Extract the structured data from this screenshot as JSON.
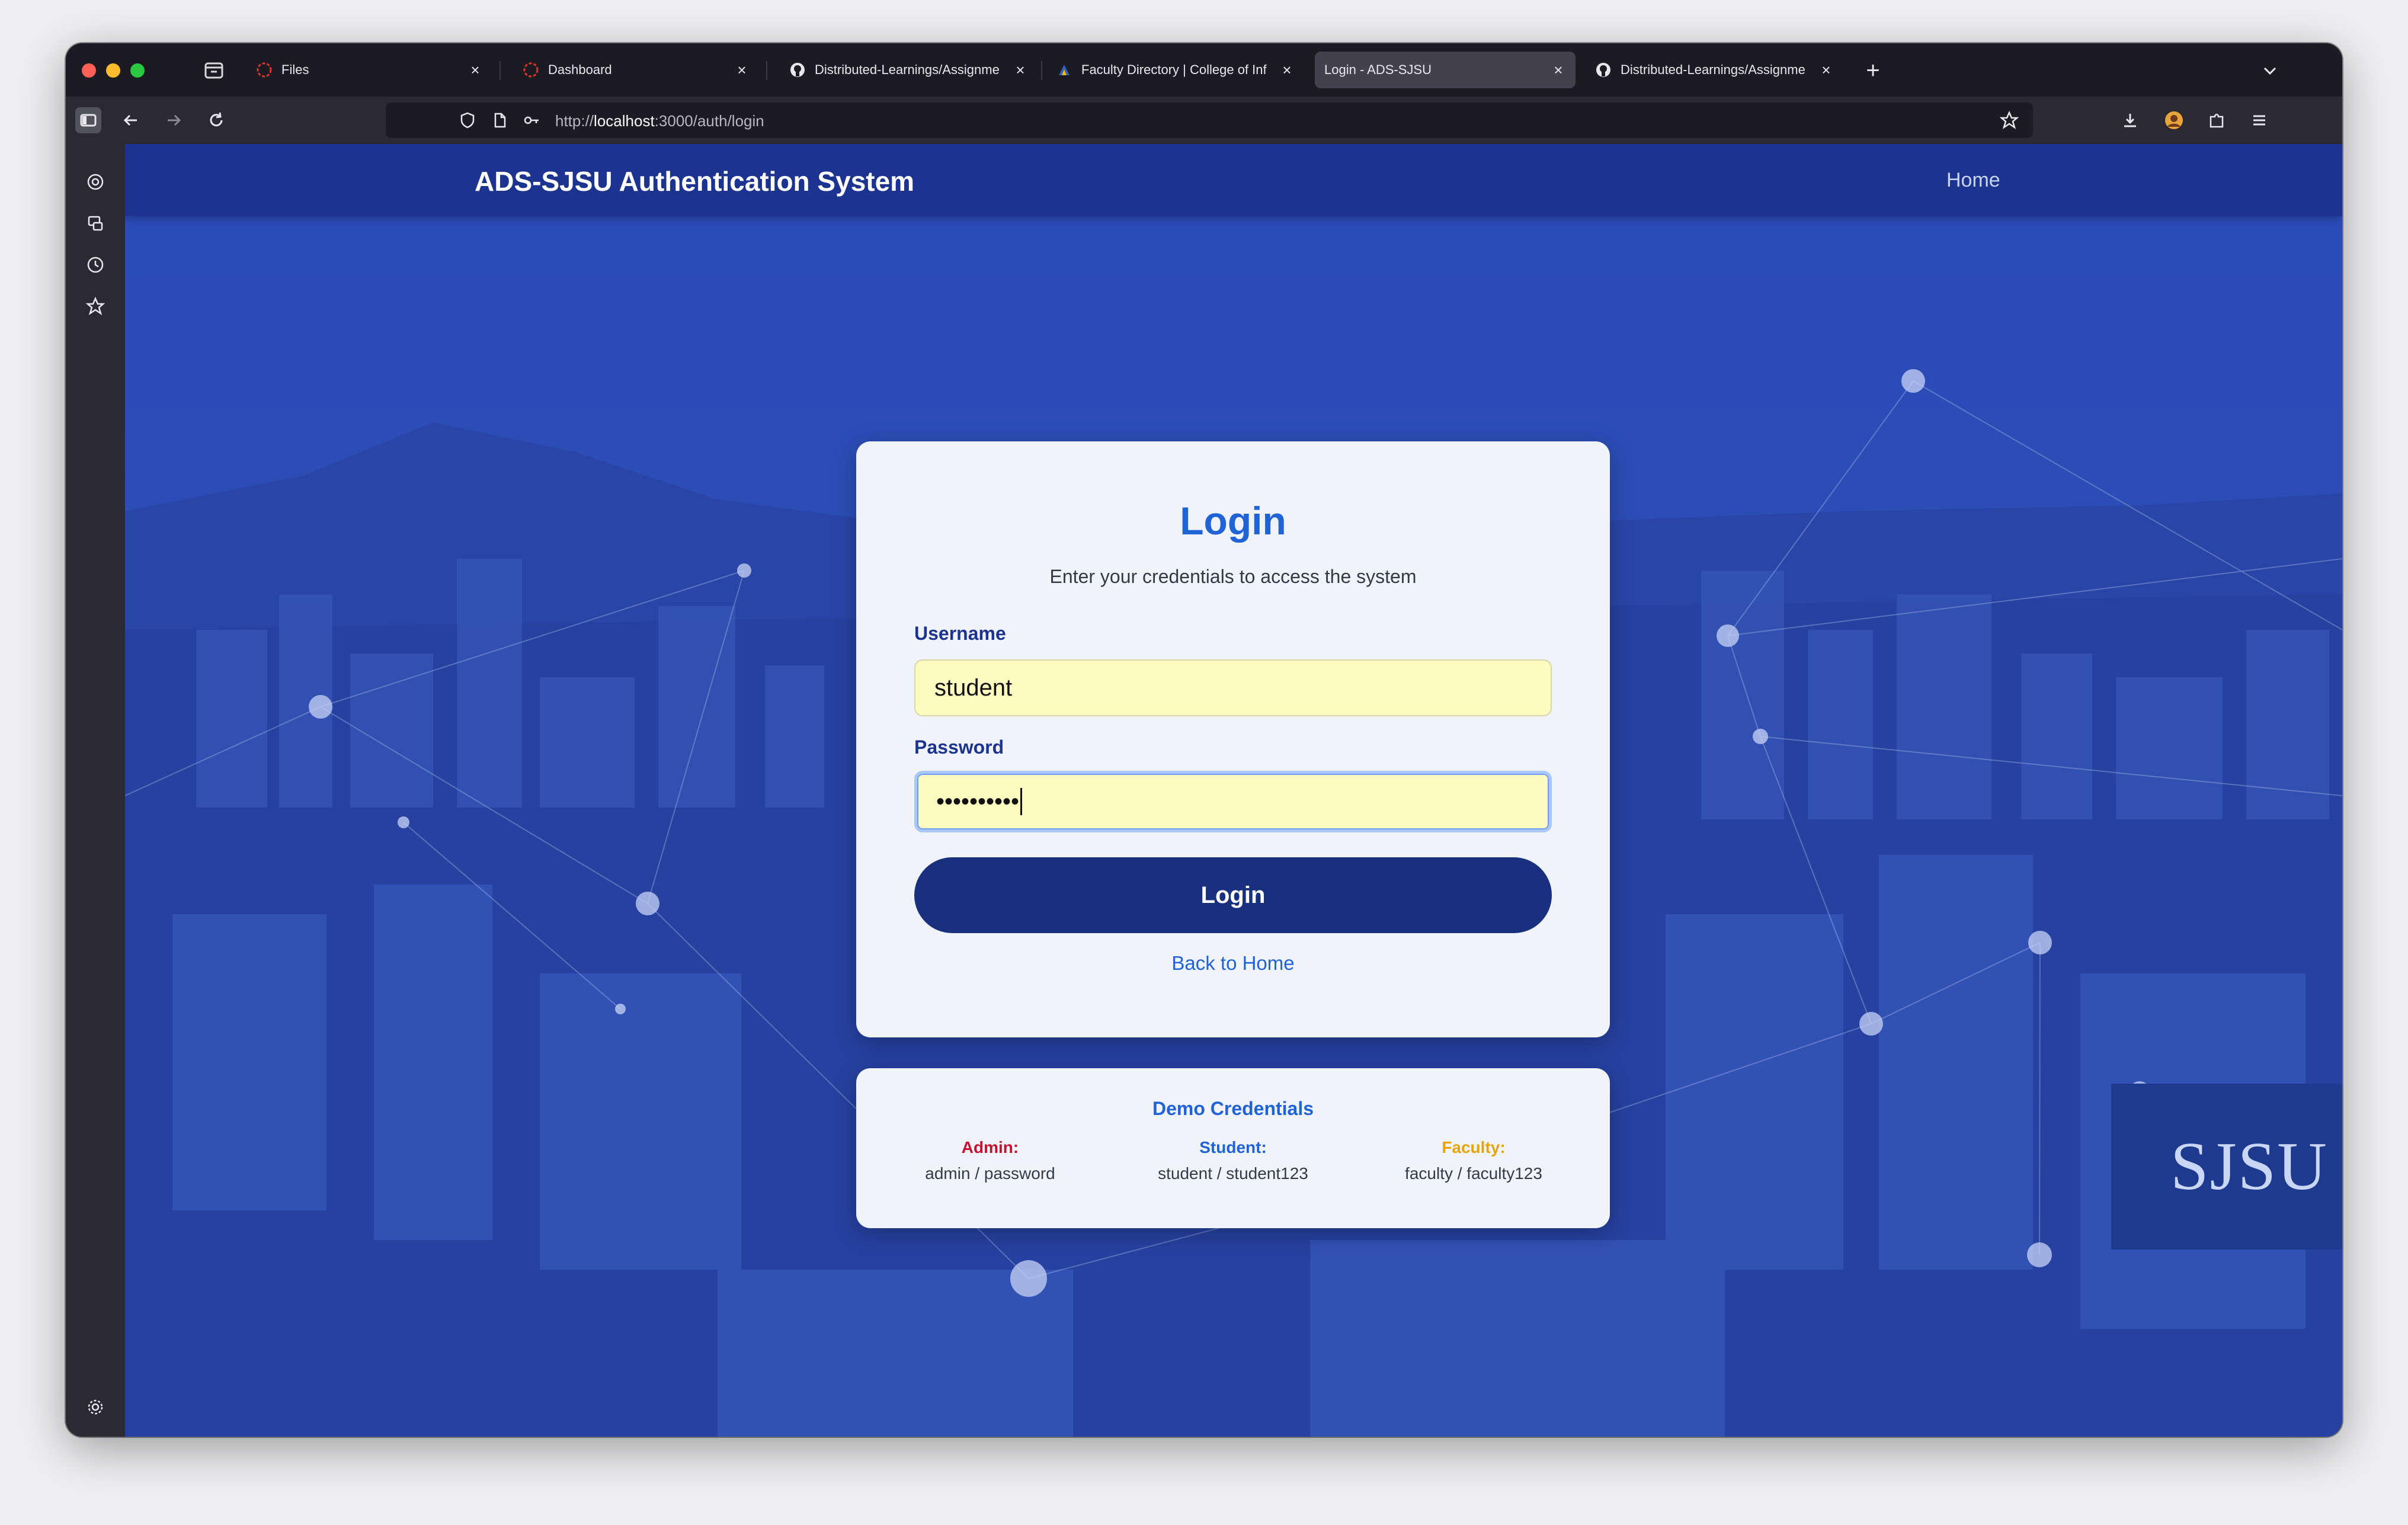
{
  "browser": {
    "tabs": [
      {
        "label": "Files",
        "favicon": "refresh-ring-icon"
      },
      {
        "label": "Dashboard",
        "favicon": "refresh-ring-icon"
      },
      {
        "label": "Distributed-Learnings/Assignme",
        "favicon": "github-icon"
      },
      {
        "label": "Faculty Directory | College of Inf",
        "favicon": "college-icon"
      },
      {
        "label": "Login - ADS-SJSU",
        "favicon": "none",
        "active": true
      },
      {
        "label": "Distributed-Learnings/Assignme",
        "favicon": "github-icon"
      }
    ],
    "url_prefix": "http://",
    "url_host": "localhost",
    "url_path": ":3000/auth/login"
  },
  "site": {
    "title": "ADS-SJSU Authentication System",
    "nav_home": "Home"
  },
  "login": {
    "heading": "Login",
    "subtitle": "Enter your credentials to access the system",
    "username_label": "Username",
    "username_value": "student",
    "password_label": "Password",
    "password_value": "••••••••••",
    "submit_label": "Login",
    "back_link": "Back to Home"
  },
  "demo": {
    "title": "Demo Credentials",
    "credentials": [
      {
        "role": "Admin:",
        "value": "admin / password",
        "color": "#c8102e"
      },
      {
        "role": "Student:",
        "value": "student / student123",
        "color": "#1f63d6"
      },
      {
        "role": "Faculty:",
        "value": "faculty / faculty123",
        "color": "#e8a400"
      }
    ]
  },
  "background_banner": "SJSU",
  "colors": {
    "header": "#1c3490",
    "accent": "#1f63d6",
    "button": "#18307d",
    "input_autofill": "#fefbc0"
  }
}
